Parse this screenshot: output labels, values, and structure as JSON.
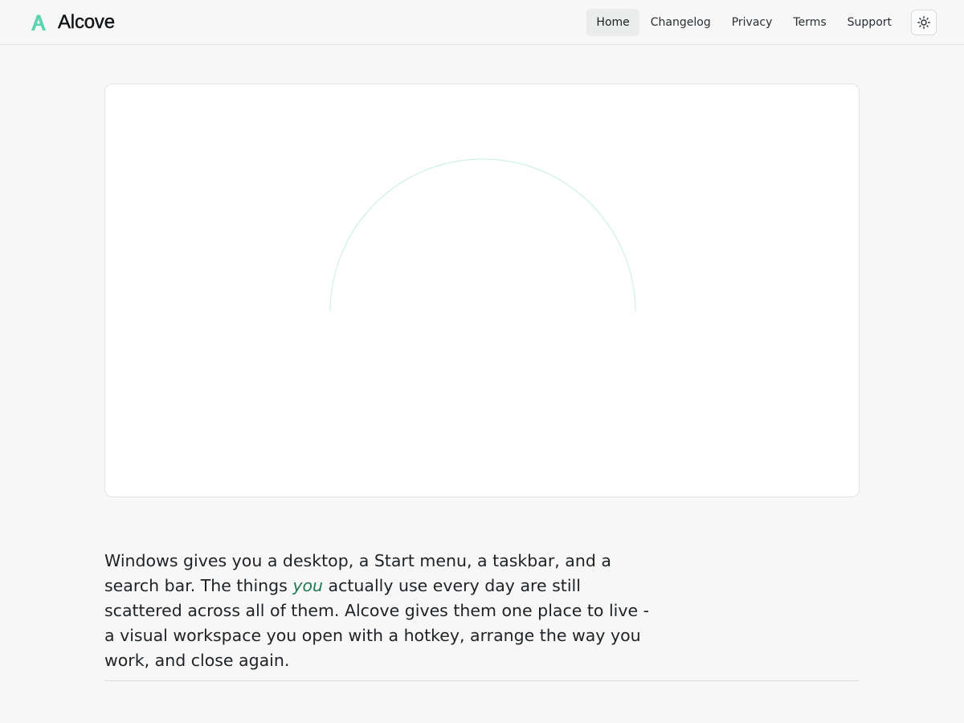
{
  "header": {
    "brand": "Alcove",
    "nav": [
      {
        "label": "Home",
        "active": true
      },
      {
        "label": "Changelog",
        "active": false
      },
      {
        "label": "Privacy",
        "active": false
      },
      {
        "label": "Terms",
        "active": false
      },
      {
        "label": "Support",
        "active": false
      }
    ],
    "theme_toggle_icon": "sun-icon"
  },
  "hero": {
    "graphic_icon": "arc-loader-icon"
  },
  "intro": {
    "before": "Windows gives you a desktop, a Start menu, a taskbar, and a search bar. The things ",
    "emphasis": "you",
    "after": " actually use every day are still scattered across all of them. Alcove gives them one place to live - a visual workspace you open with a hotkey, arrange the way you work, and close again."
  },
  "colors": {
    "accent": "#1f7a55",
    "logo": "#5fd3b0",
    "background": "#f6f7f6",
    "card": "#ffffff"
  }
}
